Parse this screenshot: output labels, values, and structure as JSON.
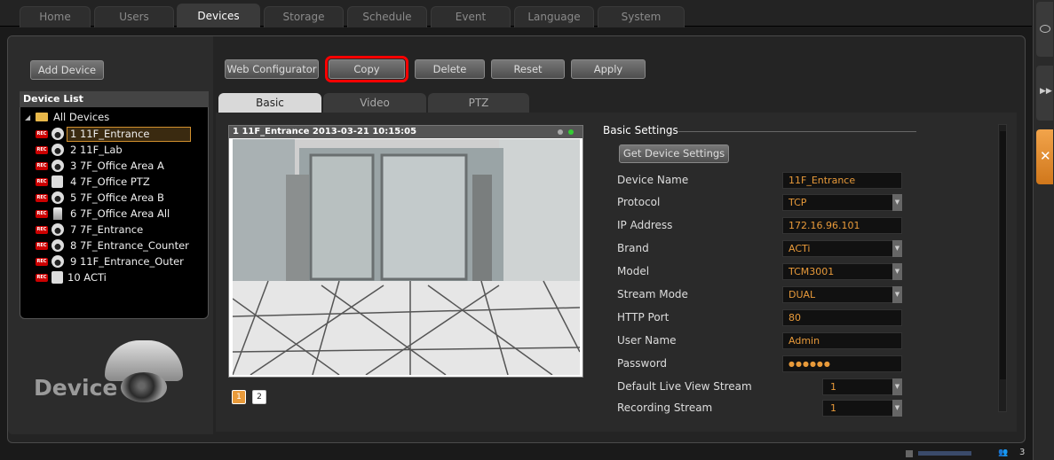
{
  "top_tabs": [
    "Home",
    "Users",
    "Devices",
    "Storage",
    "Schedule",
    "Event",
    "Language",
    "System"
  ],
  "toolbar": {
    "add_device": "Add Device",
    "web_configurator": "Web Configurator",
    "copy": "Copy",
    "delete": "Delete",
    "reset": "Reset",
    "apply": "Apply"
  },
  "device_list": {
    "title": "Device List",
    "root": "All Devices",
    "items": [
      {
        "label": "1 11F_Entrance",
        "icon": "dome-camera-icon"
      },
      {
        "label": "2 11F_Lab",
        "icon": "dome-camera-icon"
      },
      {
        "label": "3 7F_Office Area A",
        "icon": "dome-camera-icon"
      },
      {
        "label": "4 7F_Office PTZ",
        "icon": "ptz-camera-icon"
      },
      {
        "label": "5 7F_Office Area B",
        "icon": "dome-camera-icon"
      },
      {
        "label": "6 7F_Office Area All",
        "icon": "bullet-camera-icon"
      },
      {
        "label": "7 7F_Entrance",
        "icon": "dome-camera-icon"
      },
      {
        "label": "8 7F_Entrance_Counter",
        "icon": "dome-camera-icon"
      },
      {
        "label": "9 11F_Entrance_Outer",
        "icon": "dome-camera-icon"
      },
      {
        "label": "10 ACTi",
        "icon": "ptz-camera-icon"
      }
    ],
    "rec_badge": "REC"
  },
  "device_logo_text": "Device",
  "sub_tabs": [
    "Basic",
    "Video",
    "PTZ"
  ],
  "video": {
    "header": "1 11F_Entrance  2013-03-21 10:15:05",
    "channels": [
      "1",
      "2"
    ]
  },
  "settings": {
    "title": "Basic Settings",
    "get_button": "Get Device Settings",
    "fields": [
      {
        "label": "Device Name",
        "value": "11F_Entrance",
        "dropdown": false
      },
      {
        "label": "Protocol",
        "value": "TCP",
        "dropdown": true
      },
      {
        "label": "IP Address",
        "value": "172.16.96.101",
        "dropdown": false
      },
      {
        "label": "Brand",
        "value": "ACTi",
        "dropdown": true
      },
      {
        "label": "Model",
        "value": "TCM3001",
        "dropdown": true
      },
      {
        "label": "Stream Mode",
        "value": "DUAL",
        "dropdown": true
      },
      {
        "label": "HTTP Port",
        "value": "80",
        "dropdown": false
      },
      {
        "label": "User Name",
        "value": "Admin",
        "dropdown": false
      },
      {
        "label": "Password",
        "value": "●●●●●●",
        "dropdown": false
      },
      {
        "label": "Default Live View Stream",
        "value": "1",
        "dropdown": true
      },
      {
        "label": "Recording Stream",
        "value": "1",
        "dropdown": true
      }
    ]
  },
  "status": {
    "users_count": "3"
  },
  "colors": {
    "accent": "#e89a3a",
    "selection_outline": "#ff0000",
    "active_tab": "#d9d9d9"
  }
}
